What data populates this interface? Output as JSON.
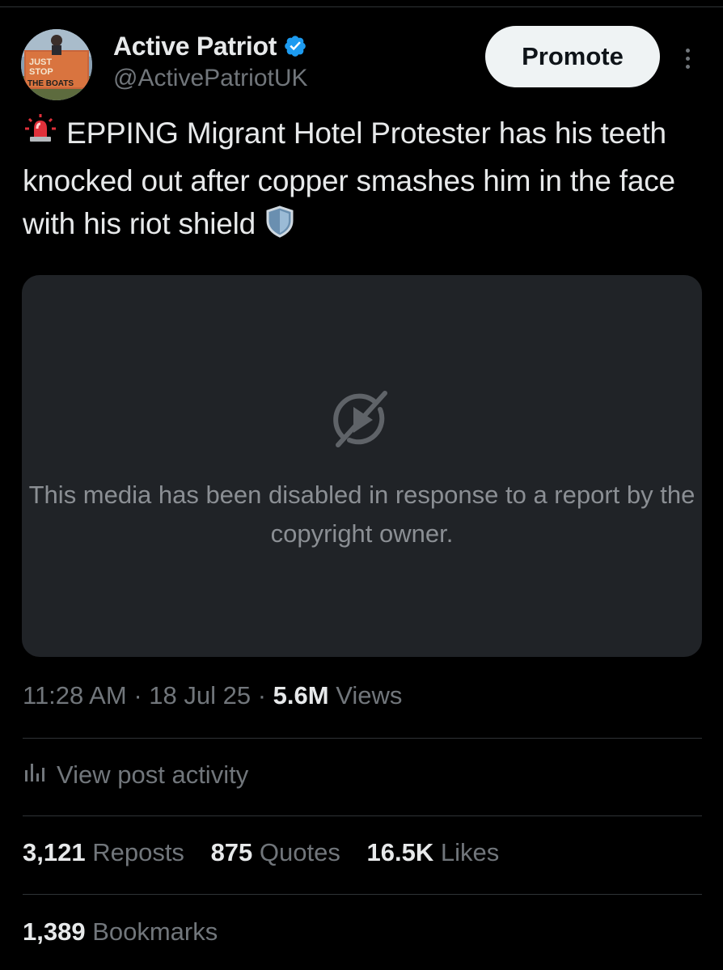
{
  "post": {
    "author": {
      "display_name": "Active Patriot",
      "handle": "@ActivePatriotUK",
      "verified": true,
      "avatar_sign_text": "JUST STOP THE BOATS"
    },
    "promote_label": "Promote",
    "text": "EPPING Migrant Hotel Protester has his teeth knocked out after copper smashes him in the face with his riot shield",
    "leading_emoji": "police-light-icon",
    "trailing_emoji": "shield-icon",
    "media": {
      "message": "This media has been disabled in response to a report by the copyright owner.",
      "icon": "video-disabled-icon"
    },
    "meta": {
      "time": "11:28 AM",
      "separator": "·",
      "date": "18 Jul 25",
      "views_count": "5.6M",
      "views_label": "Views"
    },
    "activity_label": "View post activity",
    "stats": {
      "reposts_count": "3,121",
      "reposts_label": "Reposts",
      "quotes_count": "875",
      "quotes_label": "Quotes",
      "likes_count": "16.5K",
      "likes_label": "Likes",
      "bookmarks_count": "1,389",
      "bookmarks_label": "Bookmarks"
    }
  },
  "colors": {
    "background": "#000000",
    "text_primary": "#e7e9ea",
    "text_secondary": "#71767b",
    "divider": "#2f3336",
    "media_background": "#202327",
    "verified_blue": "#1d9bf0",
    "promote_bg": "#eff3f4"
  }
}
